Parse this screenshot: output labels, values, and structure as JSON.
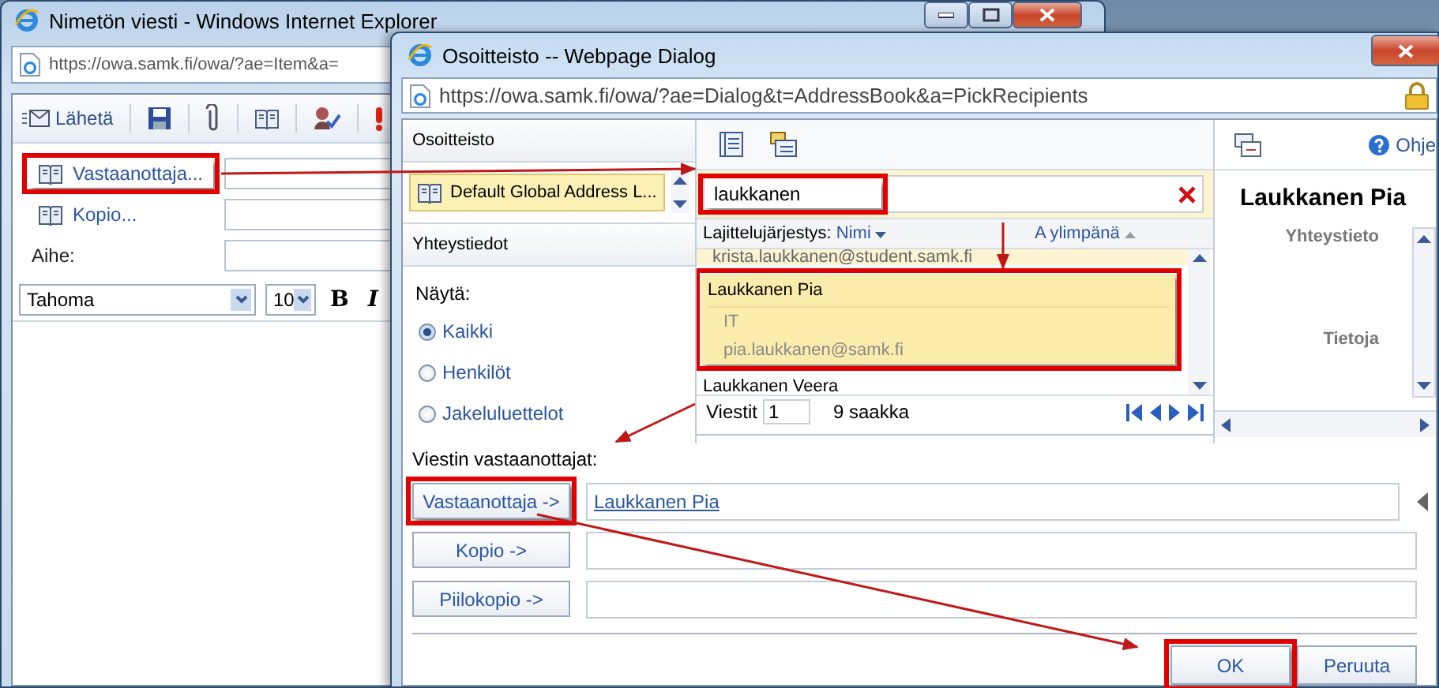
{
  "main_window": {
    "title": "Nimetön viesti - Windows Internet Explorer",
    "address": "https://owa.samk.fi/owa/?ae=Item&a=",
    "toolbar": {
      "send": "Lähetä"
    },
    "header_rows": [
      {
        "kind": "picker",
        "label": "Vastaanottaja...",
        "highlighted": true
      },
      {
        "kind": "picker",
        "label": "Kopio...",
        "highlighted": false
      },
      {
        "kind": "label",
        "label": "Aihe:",
        "highlighted": false
      }
    ],
    "format_bar": {
      "font": "Tahoma",
      "size": "10",
      "bold": "B",
      "italic": "I"
    }
  },
  "dialog": {
    "title": "Osoitteisto -- Webpage Dialog",
    "address": "https://owa.samk.fi/owa/?ae=Dialog&t=AddressBook&a=PickRecipients",
    "left_pane": {
      "header": "Osoitteisto",
      "address_list": "Default Global Address L...",
      "contacts_header": "Yhteystiedot",
      "show_label": "Näytä:",
      "show_options": [
        {
          "label": "Kaikki",
          "selected": true
        },
        {
          "label": "Henkilöt",
          "selected": false
        },
        {
          "label": "Jakeluluettelot",
          "selected": false
        }
      ]
    },
    "search": {
      "value": "laukkanen",
      "highlighted": true
    },
    "sort": {
      "label": "Lajittelujärjestys:",
      "field": "Nimi",
      "order": "A ylimpänä"
    },
    "results": [
      {
        "lines": [
          "krista.laukkanen@student.samk.fi"
        ],
        "selected": false,
        "highlighted": false
      },
      {
        "lines": [
          "Laukkanen Pia",
          "IT",
          "pia.laukkanen@samk.fi"
        ],
        "selected": true,
        "highlighted": true
      },
      {
        "lines": [
          "Laukkanen Veera"
        ],
        "selected": false,
        "highlighted": false
      }
    ],
    "pager": {
      "label": "Viestit",
      "page": "1",
      "total": "9 saakka"
    },
    "details": {
      "help": "Ohje",
      "name": "Laukkanen Pia",
      "fields": [
        "Yhteystieto",
        "Tietoja"
      ]
    },
    "recipients": {
      "label": "Viestin vastaanottajat:",
      "rows": [
        {
          "button": "Vastaanottaja ->",
          "value": "Laukkanen Pia",
          "highlighted": true
        },
        {
          "button": "Kopio ->",
          "highlighted": false
        },
        {
          "button": "Piilokopio ->",
          "highlighted": false
        }
      ]
    },
    "buttons": [
      {
        "label": "OK",
        "highlighted": true
      },
      {
        "label": "Peruuta",
        "highlighted": false
      }
    ]
  }
}
